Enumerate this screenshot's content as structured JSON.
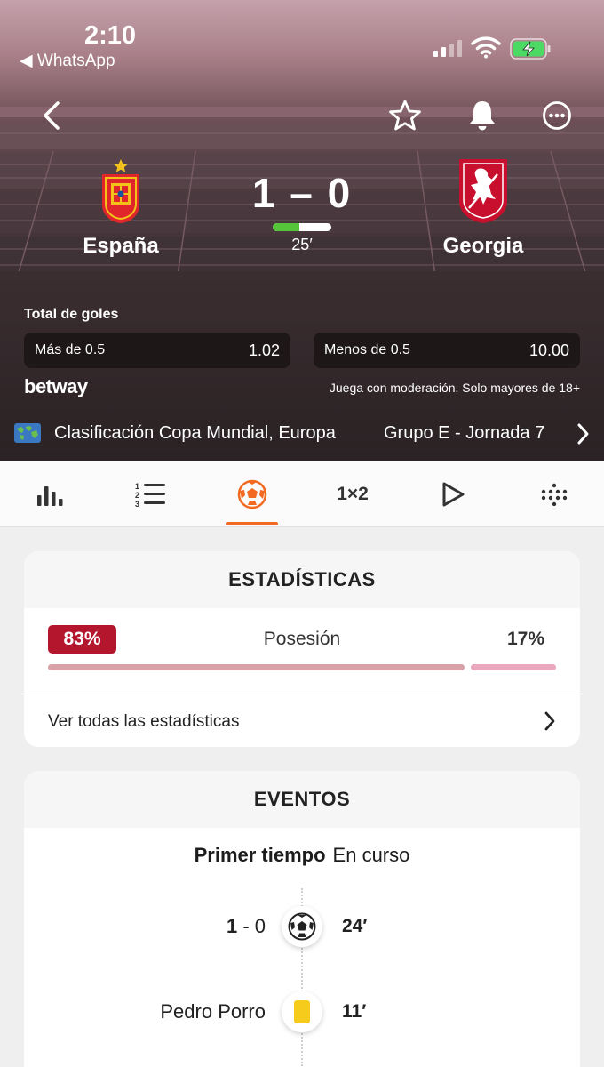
{
  "status_bar": {
    "time": "2:10",
    "back_app": "◀ WhatsApp"
  },
  "header": {
    "home_team": "España",
    "away_team": "Georgia",
    "score": "1 – 0",
    "minute": "25′",
    "match_progress": 0.45
  },
  "betting": {
    "title": "Total de goles",
    "options": [
      {
        "label": "Más de 0.5",
        "odds": "1.02"
      },
      {
        "label": "Menos de 0.5",
        "odds": "10.00"
      }
    ],
    "sponsor": "betway",
    "disclaimer": "Juega con moderación. Solo mayores de 18+"
  },
  "competition": {
    "name": "Clasificación Copa Mundial, Europa",
    "round": "Grupo E - Jornada 7"
  },
  "tabs": [
    {
      "name": "stats",
      "icon": "bar-chart-icon"
    },
    {
      "name": "standings",
      "icon": "ranked-list-icon"
    },
    {
      "name": "match",
      "icon": "soccer-ball-icon",
      "active": true
    },
    {
      "name": "odds",
      "icon": "one-x-two-icon",
      "label": "1×2"
    },
    {
      "name": "video",
      "icon": "play-icon"
    },
    {
      "name": "lineups",
      "icon": "formation-dots-icon"
    }
  ],
  "stats_card": {
    "title": "ESTADÍSTICAS",
    "home_value": "83%",
    "label": "Posesión",
    "away_value": "17%",
    "home_share": 0.83,
    "link": "Ver todas las estadísticas"
  },
  "events_card": {
    "title": "EVENTOS",
    "period": "Primer tiempo",
    "period_status": "En curso",
    "events": [
      {
        "type": "goal",
        "left_text_strong": "1",
        "left_text_rest": " - 0",
        "minute": "24′"
      },
      {
        "type": "yellow-card",
        "left_text": "Pedro Porro",
        "minute": "11′"
      }
    ]
  },
  "colors": {
    "accent": "#f26a22",
    "home_badge": "#b4162e",
    "progress_green": "#55c43b"
  }
}
